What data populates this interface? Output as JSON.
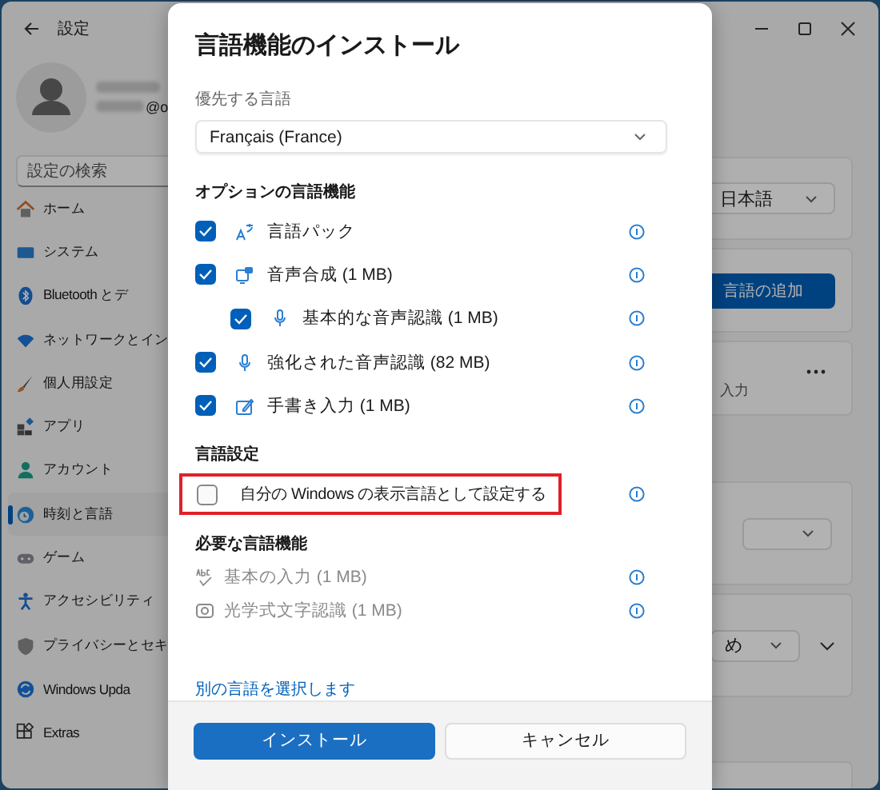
{
  "background_window": {
    "title": "設定",
    "account_fragment": "@o",
    "search": {
      "placeholder": "設定の検索"
    },
    "nav": [
      {
        "label": "ホーム",
        "selected": false
      },
      {
        "label": "システム",
        "selected": false
      },
      {
        "label": "Bluetooth とデ",
        "selected": false
      },
      {
        "label": "ネットワークとイン",
        "selected": false
      },
      {
        "label": "個人用設定",
        "selected": false
      },
      {
        "label": "アプリ",
        "selected": false
      },
      {
        "label": "アカウント",
        "selected": false
      },
      {
        "label": "時刻と言語",
        "selected": true
      },
      {
        "label": "ゲーム",
        "selected": false
      },
      {
        "label": "アクセシビリティ",
        "selected": false
      },
      {
        "label": "プライバシーとセキ",
        "selected": false
      },
      {
        "label": "Windows Upda",
        "selected": false
      },
      {
        "label": "Extras",
        "selected": false
      }
    ],
    "display_language_value": "日本語",
    "add_language_button": "言語の追加",
    "language_item_fragment": "入力",
    "region_value_fragment": "め"
  },
  "dialog": {
    "title": "言語機能のインストール",
    "preferred_language_label": "優先する言語",
    "preferred_language_value": "Français (France)",
    "optional_heading": "オプションの言語機能",
    "optional_features": [
      {
        "label": "言語パック",
        "checked": true
      },
      {
        "label": "音声合成 (1 MB)",
        "checked": true,
        "children": [
          {
            "label": "基本的な音声認識 (1 MB)",
            "checked": true
          }
        ]
      },
      {
        "label": "強化された音声認識 (82 MB)",
        "checked": true
      },
      {
        "label": "手書き入力 (1 MB)",
        "checked": true
      }
    ],
    "settings_heading": "言語設定",
    "settings_options": [
      {
        "label": "自分の Windows の表示言語として設定する",
        "checked": false,
        "highlighted": true
      }
    ],
    "required_heading": "必要な言語機能",
    "required_features": [
      {
        "label": "基本の入力 (1 MB)",
        "disabled": true
      },
      {
        "label": "光学式文字認識 (1 MB)",
        "disabled": true
      }
    ],
    "link": "別の言語を選択します",
    "buttons": [
      {
        "label": "インストール",
        "kind": "primary"
      },
      {
        "label": "キャンセル",
        "kind": "secondary"
      }
    ]
  }
}
